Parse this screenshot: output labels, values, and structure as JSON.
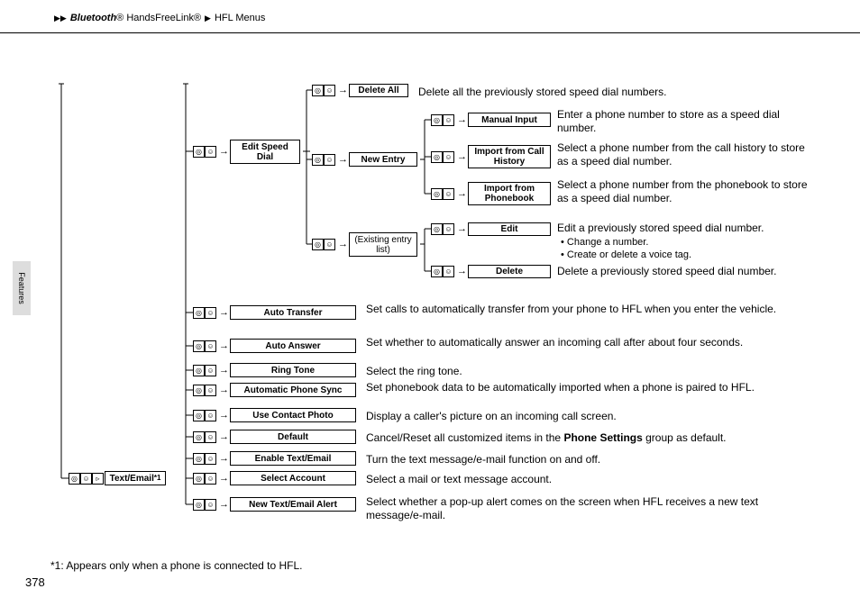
{
  "header": {
    "bt": "Bluetooth",
    "reg": "®",
    "hfl": "HandsFreeLink",
    "menus": "HFL Menus"
  },
  "sidebar": "Features",
  "pagenum": "378",
  "footnote": "*1: Appears only when a phone is connected to HFL.",
  "boxes": {
    "textEmail": "Text/Email",
    "textEmailSup": "*1",
    "editSpeedDial": "Edit Speed Dial",
    "deleteAll": "Delete All",
    "newEntry": "New Entry",
    "existing": "(Existing entry list)",
    "manualInput": "Manual Input",
    "importCH": "Import from Call History",
    "importPB": "Import from Phonebook",
    "edit": "Edit",
    "delete": "Delete",
    "autoTransfer": "Auto Transfer",
    "autoAnswer": "Auto Answer",
    "ringTone": "Ring Tone",
    "autoSync": "Automatic Phone Sync",
    "useContact": "Use Contact Photo",
    "default": "Default",
    "enableTE": "Enable Text/Email",
    "selectAcct": "Select Account",
    "newAlert": "New Text/Email Alert"
  },
  "desc": {
    "deleteAll": "Delete all the previously stored speed dial numbers.",
    "manualInput": "Enter a phone number to store as a speed dial number.",
    "importCH": "Select a phone number from the call history to store as a speed dial number.",
    "importPB": "Select a phone number from the phonebook to store as a speed dial number.",
    "edit": "Edit a previously stored speed dial number.",
    "editB1": "• Change a number.",
    "editB2": "• Create or delete a voice tag.",
    "delete": "Delete a previously stored speed dial number.",
    "autoTransfer": "Set calls to automatically transfer from your phone to HFL when you enter the vehicle.",
    "autoAnswer": "Set whether to automatically answer an incoming call after about four seconds.",
    "ringTone": "Select the ring tone.",
    "autoSync": "Set phonebook data to be automatically imported when a phone is paired to HFL.",
    "useContact": "Display a caller's picture on an incoming call screen.",
    "default1": "Cancel/Reset all customized items in the ",
    "default2": "Phone Settings",
    "default3": " group as default.",
    "enableTE": "Turn the text message/e-mail function on and off.",
    "selectAcct": "Select a mail or text message account.",
    "newAlert": "Select whether a pop-up alert comes on the screen when HFL receives a new text message/e-mail."
  }
}
